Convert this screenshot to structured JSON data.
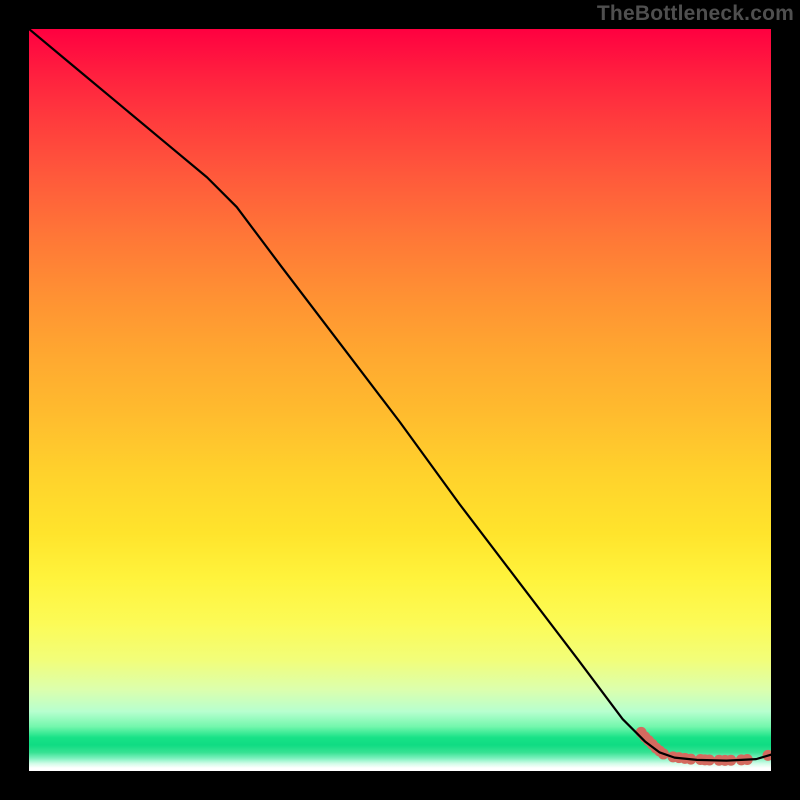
{
  "watermark": "TheBottleneck.com",
  "chart_data": {
    "type": "line",
    "title": "",
    "xlabel": "",
    "ylabel": "",
    "xlim": [
      0,
      100
    ],
    "ylim": [
      0,
      100
    ],
    "grid": false,
    "legend": false,
    "series": [
      {
        "name": "curve",
        "color": "#000000",
        "x": [
          0,
          6,
          12,
          18,
          24,
          28,
          34,
          42,
          50,
          58,
          66,
          74,
          80,
          83,
          85,
          87,
          90,
          94,
          98,
          100
        ],
        "y": [
          100,
          95,
          90,
          85,
          80,
          76,
          68,
          57.5,
          47,
          36,
          25.5,
          15,
          7,
          4,
          2.5,
          1.8,
          1.5,
          1.4,
          1.6,
          2.2
        ]
      }
    ],
    "markers": {
      "name": "data-points",
      "color": "#d46a5f",
      "points": [
        {
          "x": 82.5,
          "y": 5.2
        },
        {
          "x": 83.0,
          "y": 4.6
        },
        {
          "x": 83.5,
          "y": 4.1
        },
        {
          "x": 84.0,
          "y": 3.6
        },
        {
          "x": 84.5,
          "y": 3.1
        },
        {
          "x": 85.0,
          "y": 2.7
        },
        {
          "x": 85.5,
          "y": 2.3
        },
        {
          "x": 86.8,
          "y": 1.9
        },
        {
          "x": 87.6,
          "y": 1.8
        },
        {
          "x": 88.4,
          "y": 1.7
        },
        {
          "x": 89.2,
          "y": 1.6
        },
        {
          "x": 90.5,
          "y": 1.55
        },
        {
          "x": 91.1,
          "y": 1.5
        },
        {
          "x": 91.7,
          "y": 1.48
        },
        {
          "x": 93.0,
          "y": 1.45
        },
        {
          "x": 93.8,
          "y": 1.44
        },
        {
          "x": 94.6,
          "y": 1.45
        },
        {
          "x": 96.0,
          "y": 1.5
        },
        {
          "x": 96.8,
          "y": 1.55
        },
        {
          "x": 99.6,
          "y": 2.1
        }
      ]
    }
  }
}
